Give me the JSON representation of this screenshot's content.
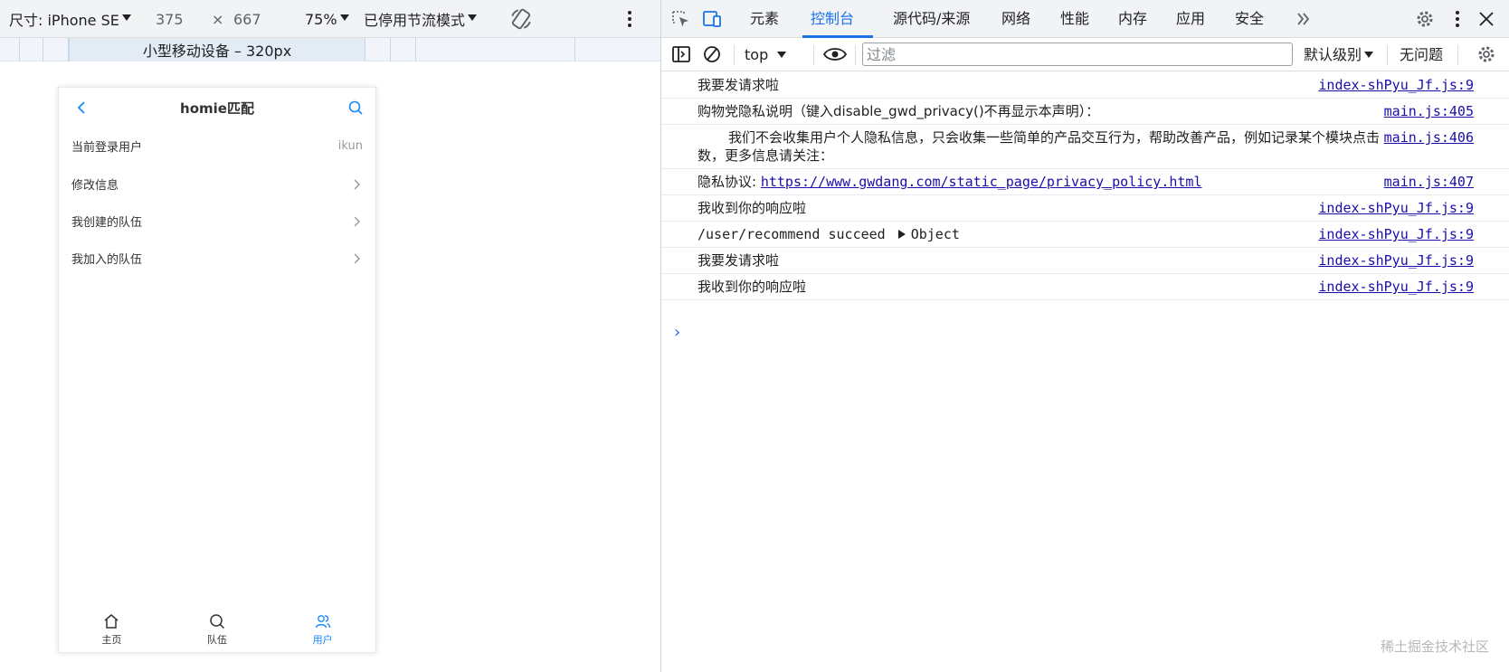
{
  "device_toolbar": {
    "dimensions_label": "尺寸: iPhone SE",
    "width": "375",
    "times": "×",
    "height": "667",
    "zoom": "75%",
    "throttle": "已停用节流模式",
    "more_icon": "more-vert-icon",
    "rotate_icon": "rotate-icon"
  },
  "ruler": {
    "selected_label": "小型移动设备 – 320px"
  },
  "phone": {
    "nav": {
      "title": "homie匹配",
      "back_icon": "chevron-left-icon",
      "search_icon": "search-icon"
    },
    "cells": [
      {
        "label": "当前登录用户",
        "value": "ikun"
      },
      {
        "label": "修改信息",
        "value": ""
      },
      {
        "label": "我创建的队伍",
        "value": ""
      },
      {
        "label": "我加入的队伍",
        "value": ""
      }
    ],
    "tabbar": [
      {
        "label": "主页",
        "icon": "home-icon",
        "active": false
      },
      {
        "label": "队伍",
        "icon": "search-icon",
        "active": false
      },
      {
        "label": "用户",
        "icon": "users-icon",
        "active": true
      }
    ],
    "accent_color": "#1989fa"
  },
  "devtools": {
    "tabs": [
      "元素",
      "控制台",
      "源代码/来源",
      "网络",
      "性能",
      "内存",
      "应用",
      "安全"
    ],
    "active_tab": "控制台",
    "filter": {
      "context": "top",
      "placeholder": "过滤",
      "level": "默认级别",
      "issues": "无问题"
    },
    "messages": [
      {
        "text": "我要发请求啦",
        "source": "index-shPyu_Jf.js:9"
      },
      {
        "text": "购物党隐私说明（键入disable_gwd_privacy()不再显示本声明）：",
        "source": "main.js:405"
      },
      {
        "text": "我们不会收集用户个人隐私信息，只会收集一些简单的产品交互行为，帮助改善产品，例如记录某个模块点击次数，更多信息请关注：",
        "source": "main.js:406"
      },
      {
        "text": "隐私协议: ",
        "link": "https://www.gwdang.com/static_page/privacy_policy.html",
        "source": "main.js:407"
      },
      {
        "text": "我收到你的响应啦",
        "source": "index-shPyu_Jf.js:9"
      },
      {
        "text": "/user/recommend succeed",
        "object": "Object",
        "source": "index-shPyu_Jf.js:9"
      },
      {
        "text": "我要发请求啦",
        "source": "index-shPyu_Jf.js:9"
      },
      {
        "text": "我收到你的响应啦",
        "source": "index-shPyu_Jf.js:9"
      }
    ],
    "prompt": "›"
  },
  "watermark": "稀土掘金技术社区"
}
